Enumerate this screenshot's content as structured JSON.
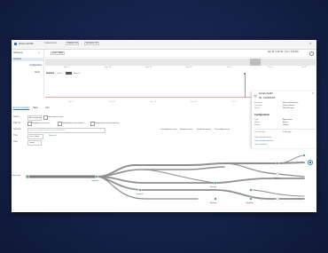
{
  "header": {
    "title": "Azure ACNF",
    "nav": [
      "Subscriptions",
      "Region: All",
      "Services: All"
    ],
    "close": "✕"
  },
  "sidebar": {
    "items": [
      "All Events",
      "Services",
      "Configuration",
      "Alerts"
    ],
    "collapse": "«"
  },
  "timeline": {
    "range_button": "Last 7 days",
    "date_range": "Sep 26, 2:30 PM - Oct 3, 2:30 PM",
    "ticks": [
      "Sep 27",
      "Sep 28",
      "Sep 29",
      "Sep 30",
      "Oct 1",
      "Oct 2",
      "Oct 3"
    ],
    "chart_header": "Issues",
    "segment": [
      "Count",
      "",
      "Impact"
    ]
  },
  "tabs": [
    "Event Correlation",
    "Table",
    "Grid"
  ],
  "filters": {
    "row1_label": "Issues",
    "row1_value": "All categories",
    "row1_checkbox": "Hide minor issues",
    "row2_label": "Filter by",
    "row2_values": [
      "Neighbors by service",
      "Dependencies by volume",
      "Dependencies by frequency"
    ],
    "row3_label": "Services",
    "row3_value": "Search and filter services in this ACNF list",
    "row3_right": [
      "Overlapping issues",
      "Related issues",
      "Duplicate issues",
      "Cascading issues"
    ],
    "row4_label": "Time",
    "row4_value": "Last 7 days",
    "row4_extra": "Show all",
    "row5_label": "View",
    "row5_value": "Graph"
  },
  "graph": {
    "nodes": [
      "Service A",
      "Gateway",
      "Compute",
      "Storage",
      "Network",
      "Database",
      "Cache"
    ]
  },
  "panel": {
    "title": "Service Health",
    "subtitle": "ID: 12345678",
    "rows": [
      {
        "label": "Resource",
        "value": "Microsoft.Network"
      },
      {
        "label": "Location",
        "value": "Status: Active"
      },
      {
        "label": "Scope",
        "value": "West Europe"
      }
    ],
    "section": "Configuration",
    "rows2": [
      {
        "label": "Type",
        "value": "Application"
      },
      {
        "label": "Status",
        "value": "Active"
      },
      {
        "label": "Region",
        "value": "Global"
      }
    ],
    "row3": {
      "label": "Last Refresh",
      "value": "2 min ago"
    },
    "links": [
      "View related events",
      "View all dependencies",
      "Go to resource"
    ]
  },
  "colors": {
    "accent": "#2f74d0",
    "node": "#5aa86a",
    "edge": "#8f8f8f",
    "marker": "#e07a7a"
  }
}
